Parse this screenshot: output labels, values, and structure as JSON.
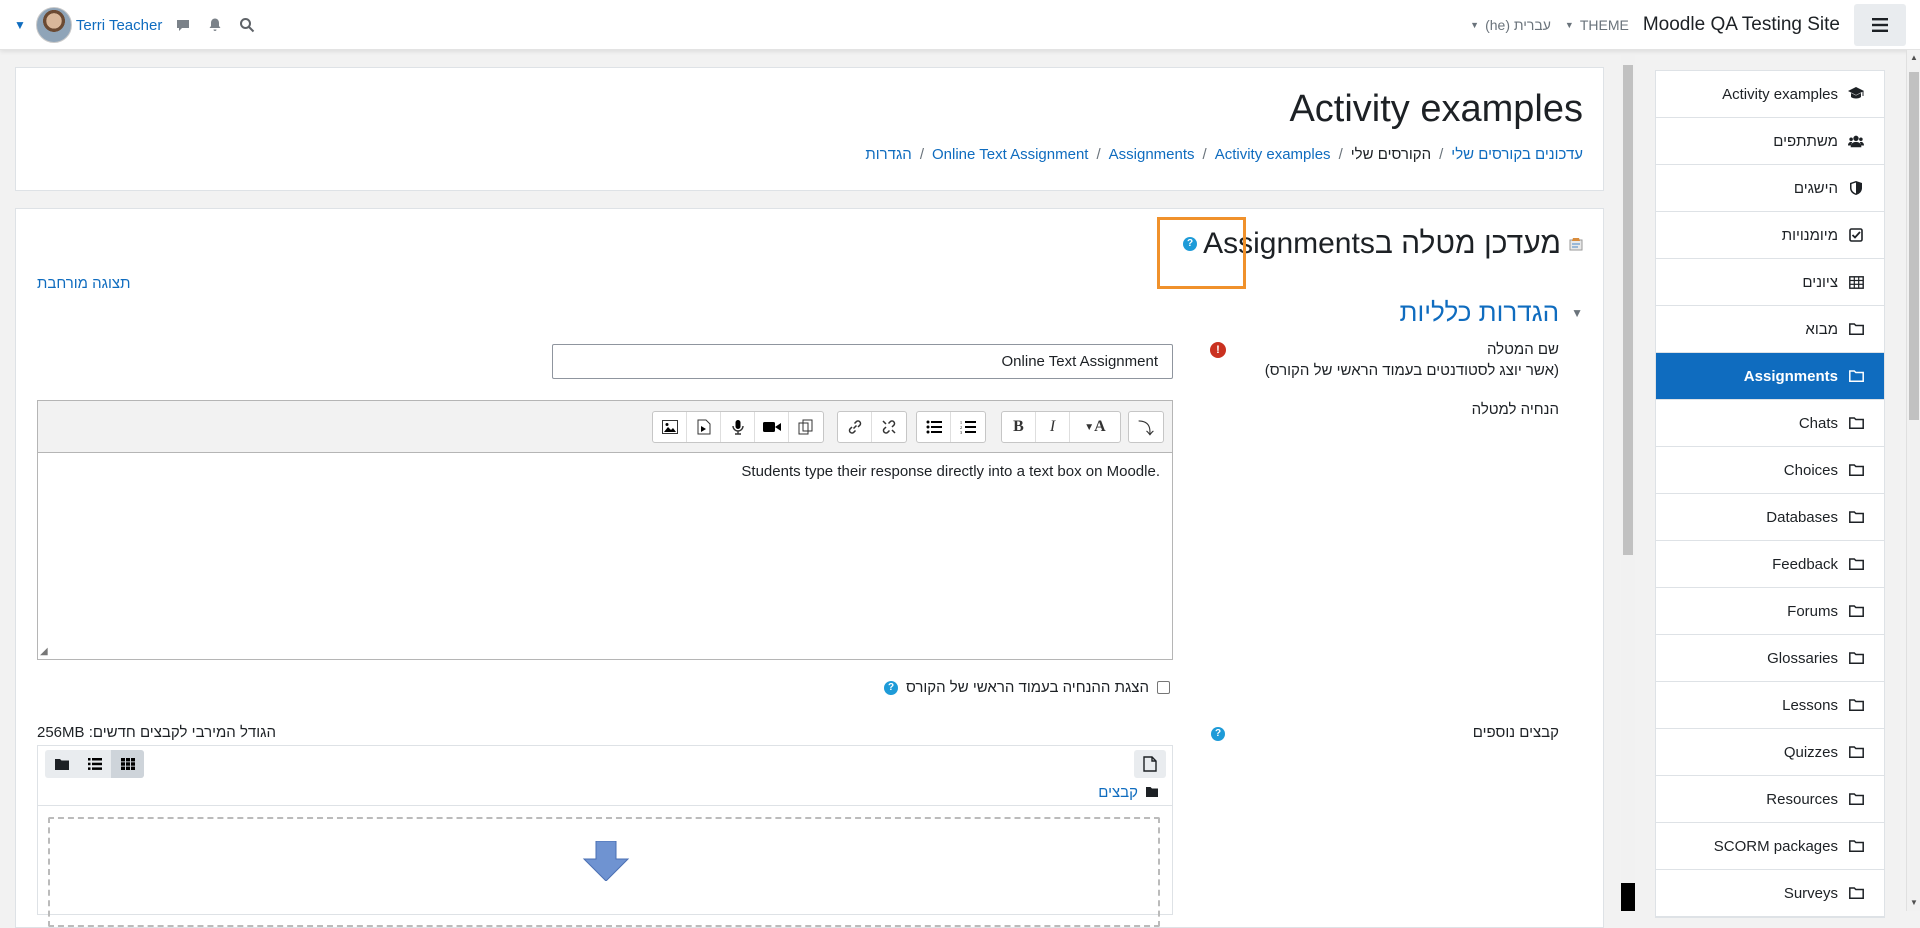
{
  "navbar": {
    "user_name": "Terri Teacher",
    "site_name": "Moodle QA Testing Site",
    "theme_label": "THEME",
    "language_label": "עברית (he)",
    "icons": [
      "chat-icon",
      "bell-icon",
      "search-icon",
      "menu-icon"
    ]
  },
  "header": {
    "title": "Activity examples",
    "breadcrumbs": [
      "עדכונים בקורסים שלי",
      "הקורסים שלי",
      "Activity examples",
      "Assignments",
      "Online Text Assignment",
      "הגדרות"
    ]
  },
  "drawer": {
    "items": [
      {
        "label": "Activity examples",
        "icon": "graduation-cap-icon",
        "active": false
      },
      {
        "label": "משתתפים",
        "icon": "users-icon",
        "active": false
      },
      {
        "label": "הישגים",
        "icon": "shield-icon",
        "active": false
      },
      {
        "label": "מיומנויות",
        "icon": "check-square-icon",
        "active": false
      },
      {
        "label": "ציונים",
        "icon": "table-icon",
        "active": false
      },
      {
        "label": "מבוא",
        "icon": "folder-icon",
        "active": false
      },
      {
        "label": "Assignments",
        "icon": "folder-icon",
        "active": true
      },
      {
        "label": "Chats",
        "icon": "folder-icon",
        "active": false
      },
      {
        "label": "Choices",
        "icon": "folder-icon",
        "active": false
      },
      {
        "label": "Databases",
        "icon": "folder-icon",
        "active": false
      },
      {
        "label": "Feedback",
        "icon": "folder-icon",
        "active": false
      },
      {
        "label": "Forums",
        "icon": "folder-icon",
        "active": false
      },
      {
        "label": "Glossaries",
        "icon": "folder-icon",
        "active": false
      },
      {
        "label": "Lessons",
        "icon": "folder-icon",
        "active": false
      },
      {
        "label": "Quizzes",
        "icon": "folder-icon",
        "active": false
      },
      {
        "label": "Resources",
        "icon": "folder-icon",
        "active": false
      },
      {
        "label": "SCORM packages",
        "icon": "folder-icon",
        "active": false
      },
      {
        "label": "Surveys",
        "icon": "folder-icon",
        "active": false
      }
    ]
  },
  "form": {
    "heading": "מעדכן מטלה בAssignments",
    "expand_all": "תצוגה מורחבת",
    "section_title": "הגדרות כלליות",
    "name_label": "שם המטלה",
    "name_sublabel": "(אשר יוצג לסטודנטים בעמוד הראשי של הקורס)",
    "name_value": "Online Text Assignment",
    "description_label": "הנחיה למטלה",
    "description_text": "Students type their response directly into a text box on Moodle.",
    "show_description_label": "הצגת ההנחיה בעמוד הראשי של הקורס",
    "additional_files_label": "קבצים נוספים",
    "max_size_text": "הגודל המירבי לקבצים חדשים: 256MB",
    "files_folder": "קבצים"
  },
  "colors": {
    "accent": "#0f6cbf",
    "highlight": "#f0912b",
    "error": "#ca3120",
    "help": "#1e9bd8"
  }
}
